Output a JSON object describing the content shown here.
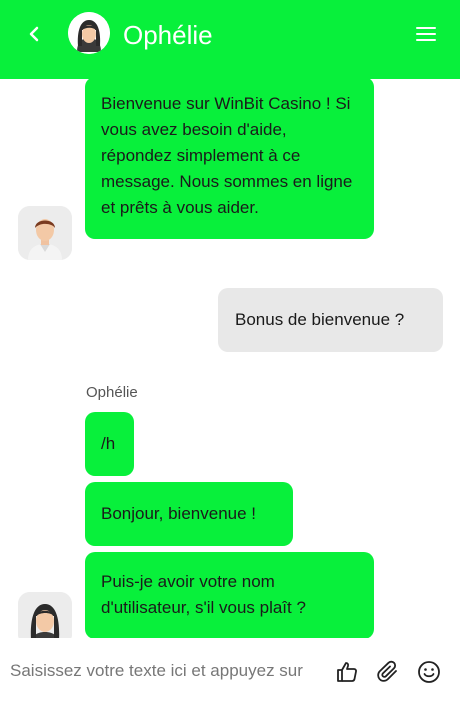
{
  "header": {
    "title": "Ophélie",
    "back_icon": "chevron-left-icon",
    "menu_icon": "hamburger-menu-icon",
    "background": "#08f03b"
  },
  "messages": [
    {
      "from": "agent",
      "text": "Bienvenue sur WinBit Casino ! Si vous avez besoin d'aide, répondez simplement à ce message. Nous sommes en ligne et prêts à vous aider.",
      "avatar": "male-agent-avatar"
    },
    {
      "from": "user",
      "text": "Bonus de bienvenue ?"
    },
    {
      "from": "agent",
      "sender": "Ophélie",
      "text": "/h"
    },
    {
      "from": "agent",
      "text": "Bonjour, bienvenue !"
    },
    {
      "from": "agent",
      "text": "Puis-je avoir votre nom d'utilisateur, s'il vous plaît ?",
      "avatar": "female-agent-avatar"
    }
  ],
  "composer": {
    "placeholder": "Saisissez votre texte ici et appuyez sur",
    "like_icon": "thumbs-up-icon",
    "attach_icon": "paperclip-icon",
    "emoji_icon": "smiley-icon"
  },
  "colors": {
    "accent": "#08f03b",
    "user_bubble": "#e8e8e8"
  }
}
